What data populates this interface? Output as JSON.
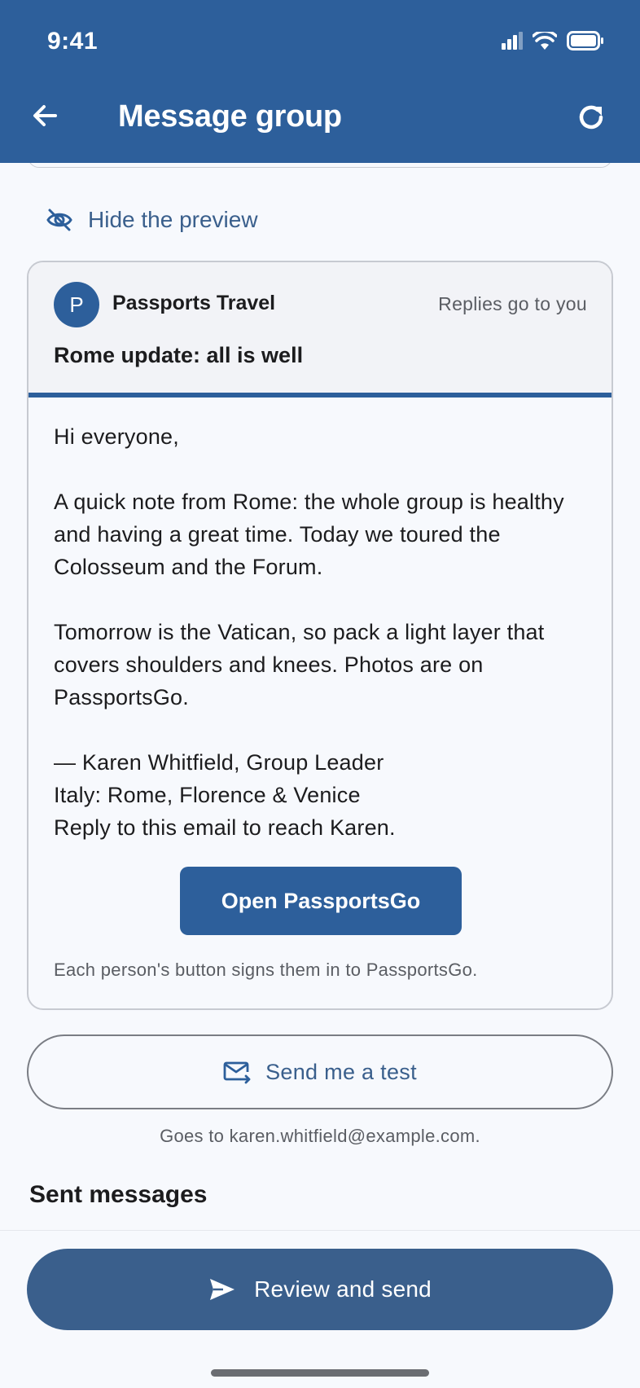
{
  "status_bar": {
    "time": "9:41"
  },
  "app_bar": {
    "title": "Message group"
  },
  "hide_preview": {
    "label": "Hide the preview"
  },
  "preview": {
    "avatar_letter": "P",
    "sender": "Passports Travel",
    "replies_note": "Replies go to you",
    "subject": "Rome update: all is well",
    "greeting": "Hi everyone,",
    "paragraph_1": "A quick note from Rome: the whole group is healthy and having a great time. Today we toured the Colosseum and the Forum.",
    "paragraph_2": "Tomorrow is the Vatican, so pack a light layer that covers shoulders and knees. Photos are on PassportsGo.",
    "signature_1": "— Karen Whitfield, Group Leader",
    "signature_2": "Italy: Rome, Florence & Venice",
    "signature_3": "Reply to this email to reach Karen.",
    "cta_label": "Open PassportsGo",
    "footnote": "Each person's button signs them in to PassportsGo."
  },
  "test": {
    "button_label": "Send me a test",
    "note": "Goes to karen.whitfield@example.com."
  },
  "sent_section": {
    "title": "Sent messages"
  },
  "bottom": {
    "send_label": "Review and send"
  },
  "colors": {
    "primary": "#2d5f9b",
    "button": "#3a5f8c",
    "background": "#f7f9fd"
  }
}
